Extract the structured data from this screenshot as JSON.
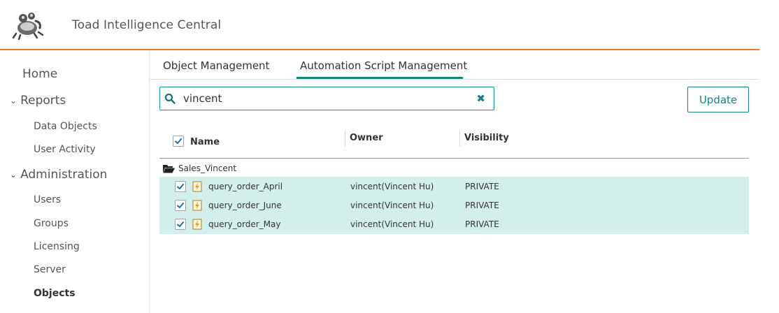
{
  "header": {
    "title": "Toad Intelligence Central",
    "logo_icon": "toad-logo-icon",
    "accent_color": "#e07a3c"
  },
  "sidebar": {
    "home": "Home",
    "reports": {
      "label": "Reports",
      "items": [
        "Data Objects",
        "User Activity"
      ]
    },
    "administration": {
      "label": "Administration",
      "items": [
        "Users",
        "Groups",
        "Licensing",
        "Server",
        "Objects"
      ]
    },
    "active_item": "Objects"
  },
  "tabs": [
    {
      "label": "Object Management",
      "active": false
    },
    {
      "label": "Automation Script Management",
      "active": true
    }
  ],
  "search": {
    "value": "vincent",
    "placeholder": ""
  },
  "update_button": "Update",
  "table": {
    "columns": [
      "Name",
      "Owner",
      "Visibility"
    ],
    "header_checked": true,
    "folder": "Sales_Vincent",
    "rows": [
      {
        "name": "query_order_April",
        "owner": "vincent(Vincent Hu)",
        "visibility": "PRIVATE",
        "checked": true
      },
      {
        "name": "query_order_June",
        "owner": "vincent(Vincent Hu)",
        "visibility": "PRIVATE",
        "checked": true
      },
      {
        "name": "query_order_May",
        "owner": "vincent(Vincent Hu)",
        "visibility": "PRIVATE",
        "checked": true
      }
    ]
  },
  "colors": {
    "teal": "#1a7f86",
    "selected_row": "#d3efec"
  }
}
